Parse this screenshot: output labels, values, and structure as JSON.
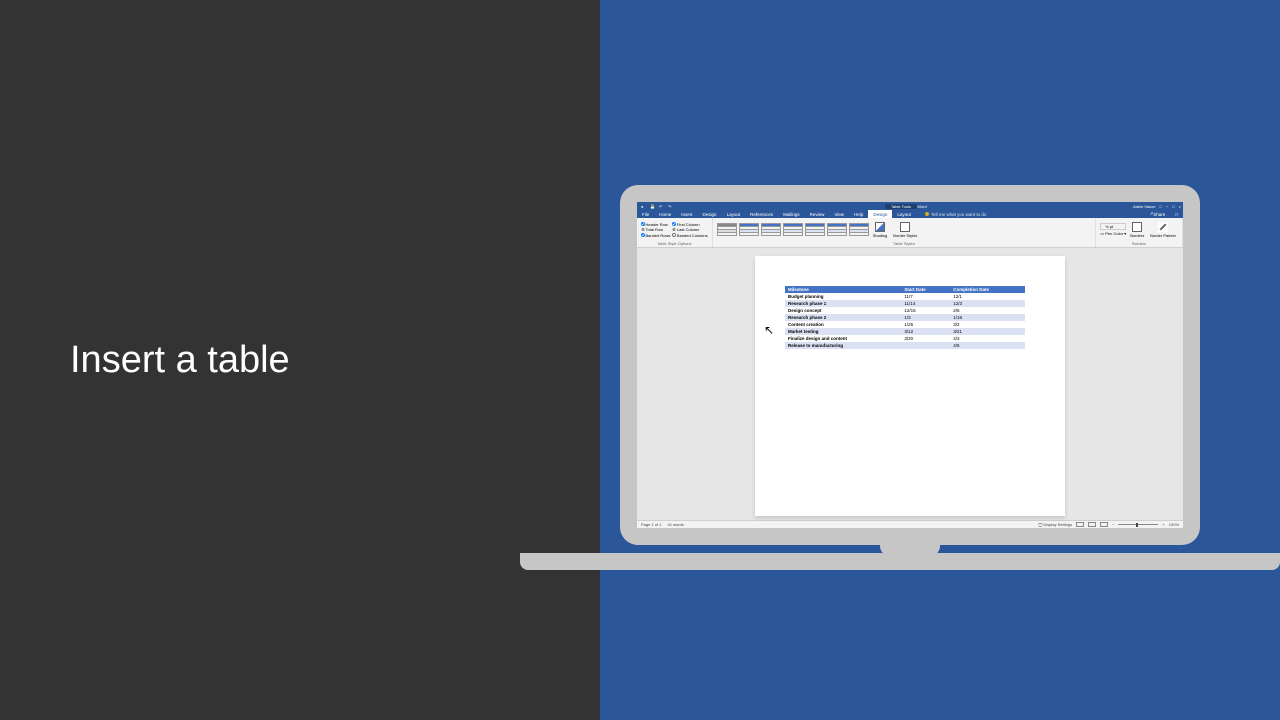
{
  "left": {
    "title": "Insert a table"
  },
  "window": {
    "doc_title": "Document2 - Word",
    "context_tab": "Table Tools",
    "user": "Adele Vance",
    "share": "Share",
    "window_controls": [
      "−",
      "□",
      "×"
    ]
  },
  "tabs": {
    "file": "File",
    "home": "Home",
    "insert": "Insert",
    "design": "Design",
    "layout": "Layout",
    "references": "References",
    "mailings": "Mailings",
    "review": "Review",
    "view": "View",
    "help": "Help",
    "tbl_design": "Design",
    "tbl_layout": "Layout",
    "tell_me": "Tell me what you want to do"
  },
  "ribbon": {
    "options": {
      "header_row": "Header Row",
      "total_row": "Total Row",
      "banded_rows": "Banded Rows",
      "first_column": "First Column",
      "last_column": "Last Column",
      "banded_columns": "Banded Columns",
      "group_label": "Table Style Options"
    },
    "styles_group": "Table Styles",
    "shading": "Shading",
    "border_styles": "Border Styles",
    "pen_weight": "½ pt",
    "pen_color": "Pen Color",
    "borders": "Borders",
    "border_painter": "Border Painter",
    "borders_group": "Borders"
  },
  "table": {
    "headers": [
      "Milestone",
      "Start Date",
      "Completion Date"
    ],
    "rows": [
      [
        "Budget planning",
        "11/7",
        "12/1"
      ],
      [
        "Research phase 1",
        "11/14",
        "12/3"
      ],
      [
        "Design concept",
        "12/15",
        "2/6"
      ],
      [
        "Research phase 2",
        "1/3",
        "1/18"
      ],
      [
        "Content creation",
        "1/25",
        "3/2"
      ],
      [
        "Market testing",
        "3/12",
        "3/21"
      ],
      [
        "Finalize design and content",
        "3/20",
        "4/3"
      ],
      [
        "Release to manufacturing",
        "",
        "4/5"
      ]
    ]
  },
  "status": {
    "page": "Page 1 of 1",
    "words": "41 words",
    "display": "Display Settings",
    "zoom": "100%"
  }
}
